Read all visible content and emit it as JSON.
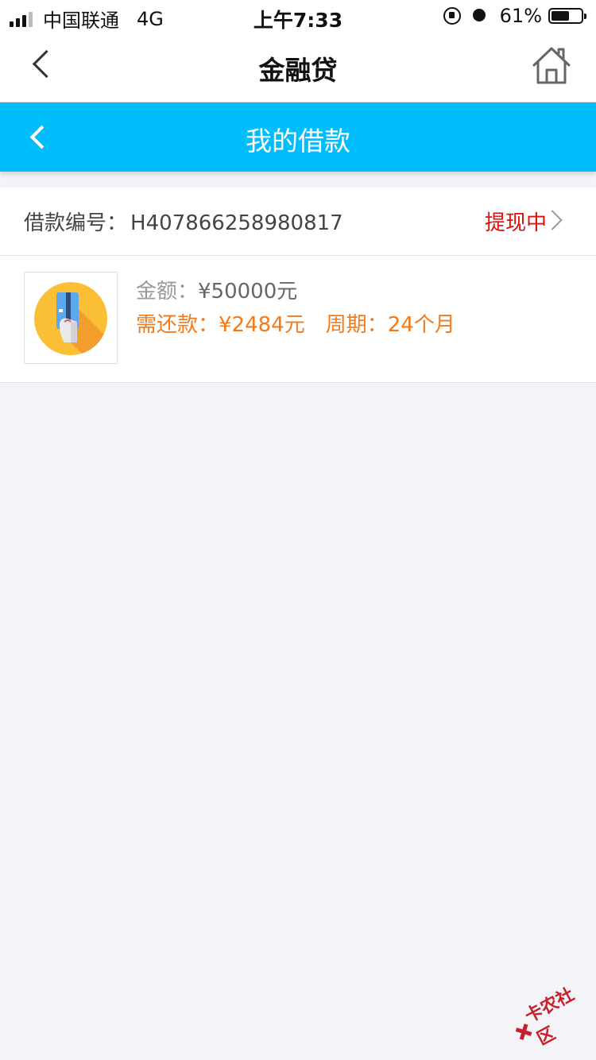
{
  "status_bar": {
    "carrier": "中国联通",
    "network": "4G",
    "time": "上午7:33",
    "battery_pct": "61%",
    "battery_level": 0.61
  },
  "nav": {
    "title": "金融贷",
    "icons": {
      "back": "chevron-left-icon",
      "home": "home-icon"
    }
  },
  "header": {
    "title": "我的借款"
  },
  "loan": {
    "id_label": "借款编号：",
    "id_value": "H407866258980817",
    "status": "提现中",
    "amount_label": "金额：",
    "amount_value": "¥50000元",
    "repay_label": "需还款：",
    "repay_value": "¥2484元",
    "period_label": "周期：",
    "period_value": "24个月"
  },
  "watermark": {
    "text": "卡农社区"
  },
  "colors": {
    "header_blue": "#00bdfb",
    "status_red": "#e40b0b",
    "repay_orange": "#f27a1a",
    "background": "#f3f3f8"
  }
}
